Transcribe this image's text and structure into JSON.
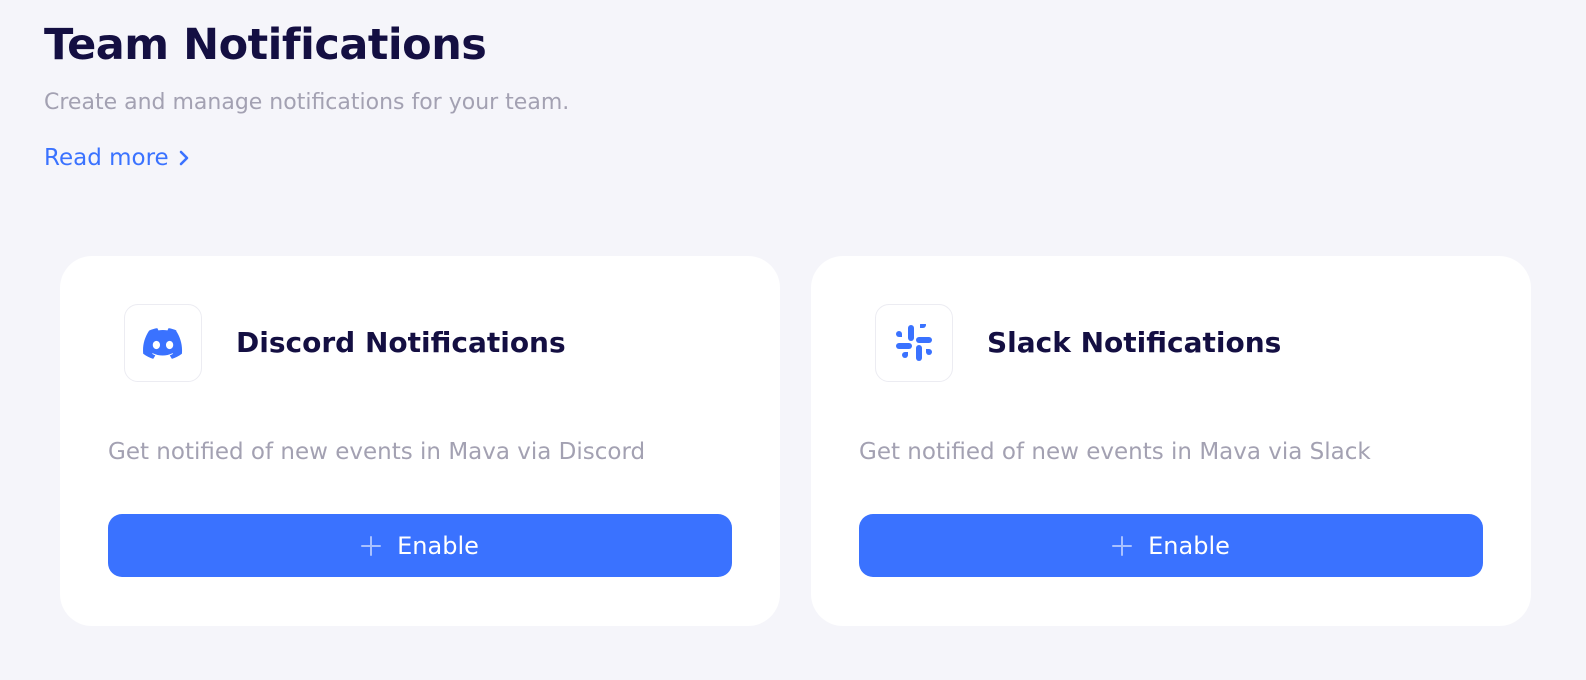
{
  "header": {
    "title": "Team Notifications",
    "subtitle": "Create and manage notifications for your team.",
    "read_more": "Read more"
  },
  "cards": [
    {
      "icon": "discord-icon",
      "title": "Discord Notifications",
      "description": "Get notified of new events in Mava via Discord",
      "button_label": "Enable"
    },
    {
      "icon": "slack-icon",
      "title": "Slack Notifications",
      "description": "Get notified of new events in Mava via Slack",
      "button_label": "Enable"
    }
  ],
  "colors": {
    "accent": "#3a72ff",
    "title": "#140f42",
    "muted": "#a3a1b2",
    "background": "#f5f5fa"
  }
}
